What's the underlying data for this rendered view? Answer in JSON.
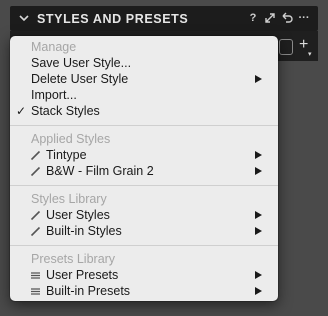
{
  "panel": {
    "title": "STYLES AND PRESETS",
    "icons": [
      "help-icon",
      "expand-icon",
      "reset-icon",
      "more-icon"
    ],
    "help_glyph": "?",
    "more_glyph": "···",
    "add_glyph": "+",
    "add_caret": "▾"
  },
  "menu": {
    "manage_heading": "Manage",
    "save_user_style": "Save User Style...",
    "delete_user_style": "Delete User Style",
    "import": "Import...",
    "stack_styles": "Stack Styles",
    "stack_styles_checked": true,
    "check_mark": "✓",
    "applied_heading": "Applied Styles",
    "applied_items": [
      "Tintype",
      "B&W - Film Grain 2"
    ],
    "library_heading": "Styles Library",
    "library_items": [
      "User Styles",
      "Built-in Styles"
    ],
    "presets_heading": "Presets Library",
    "presets_items": [
      "User Presets",
      "Built-in Presets"
    ]
  },
  "colors": {
    "menu_bg": "#ececec",
    "header_bg": "#1c1c1c",
    "heading_text": "#a6a6a6"
  }
}
